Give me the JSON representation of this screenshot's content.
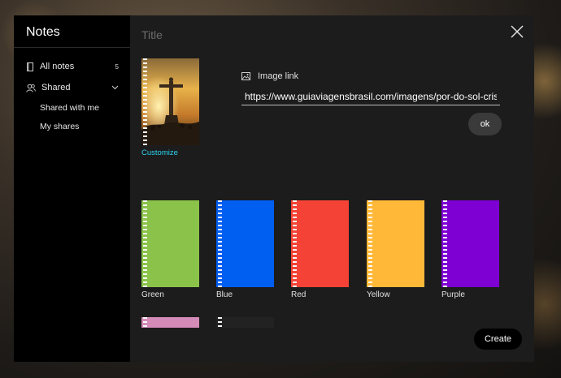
{
  "sidebar": {
    "brand": "Notes",
    "items": [
      {
        "label": "All notes",
        "count": "5",
        "icon": "notebook-icon"
      },
      {
        "label": "Shared",
        "icon": "users-icon",
        "expand_icon": "chevron-down-icon"
      }
    ],
    "sub_items": [
      {
        "label": "Shared with me"
      },
      {
        "label": "My shares"
      }
    ]
  },
  "dialog": {
    "title_placeholder": "Title",
    "customize_label": "Customize",
    "image_link_label": "Image link",
    "image_link_value": "https://www.guiaviagensbrasil.com/imagens/por-do-sol-cristo-redentor.jpg",
    "ok_label": "ok",
    "create_label": "Create",
    "covers": [
      {
        "label": "Green",
        "color": "#8bc34a"
      },
      {
        "label": "Blue",
        "color": "#005ef0"
      },
      {
        "label": "Red",
        "color": "#f44336"
      },
      {
        "label": "Yellow",
        "color": "#ffb838"
      },
      {
        "label": "Purple",
        "color": "#7e00d2"
      },
      {
        "label": "",
        "color": "#d48bb8"
      },
      {
        "label": "",
        "color": "#222222"
      }
    ]
  }
}
